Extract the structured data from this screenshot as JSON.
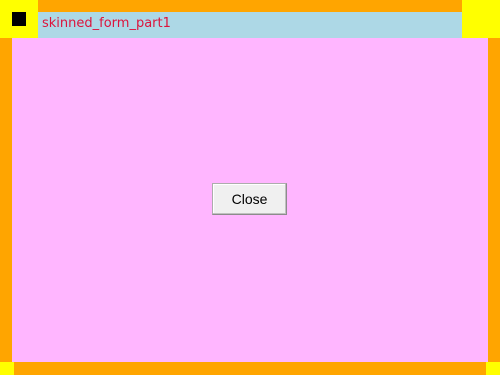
{
  "window": {
    "title": "skinned_form_part1",
    "icon": "app-icon"
  },
  "client": {
    "close_label": "Close"
  },
  "colors": {
    "frame": "#ffa500",
    "corner": "#ffff00",
    "titlebar": "#add8e6",
    "title_text": "#dc143c",
    "client_background": "#ffb6ff",
    "icon": "#000000"
  }
}
